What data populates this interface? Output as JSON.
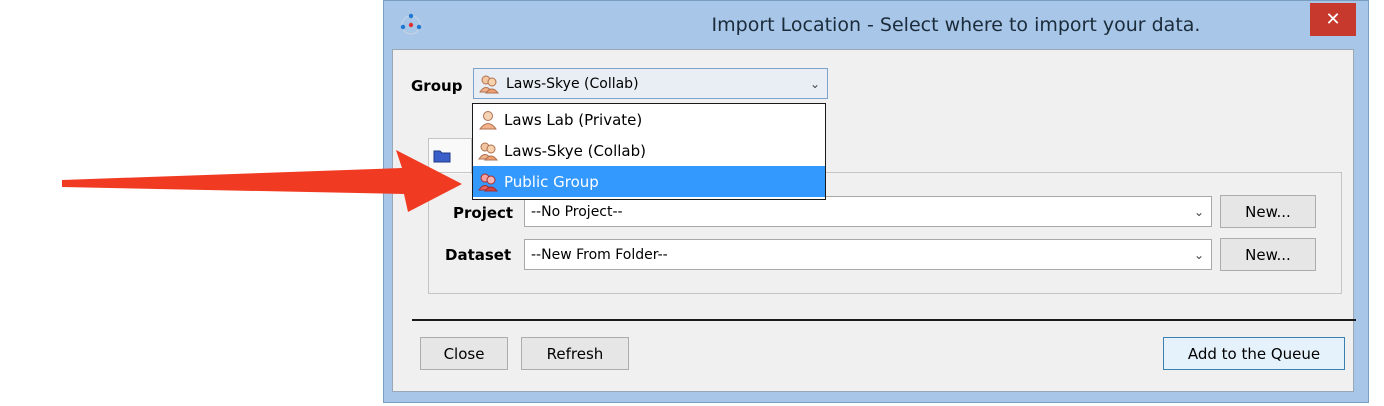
{
  "window": {
    "title": "Import Location - Select where to import your data.",
    "close_label": "✕"
  },
  "group": {
    "label": "Group",
    "selected": "Laws-Skye (Collab)",
    "options": [
      "Laws Lab (Private)",
      "Laws-Skye (Collab)",
      "Public Group"
    ],
    "highlighted_index": 2
  },
  "project": {
    "label": "Project",
    "value": "--No Project--",
    "new_label": "New..."
  },
  "dataset": {
    "label": "Dataset",
    "value": "--New From Folder--",
    "new_label": "New..."
  },
  "footer": {
    "close_label": "Close",
    "refresh_label": "Refresh",
    "add_label": "Add to the Queue"
  },
  "colors": {
    "highlight": "#3399ff",
    "annotation_arrow": "#f03b22",
    "close_button": "#c7392c"
  },
  "icons": [
    "app-icon",
    "person-icon",
    "folder-icon",
    "chevron-down-icon",
    "close-icon"
  ]
}
